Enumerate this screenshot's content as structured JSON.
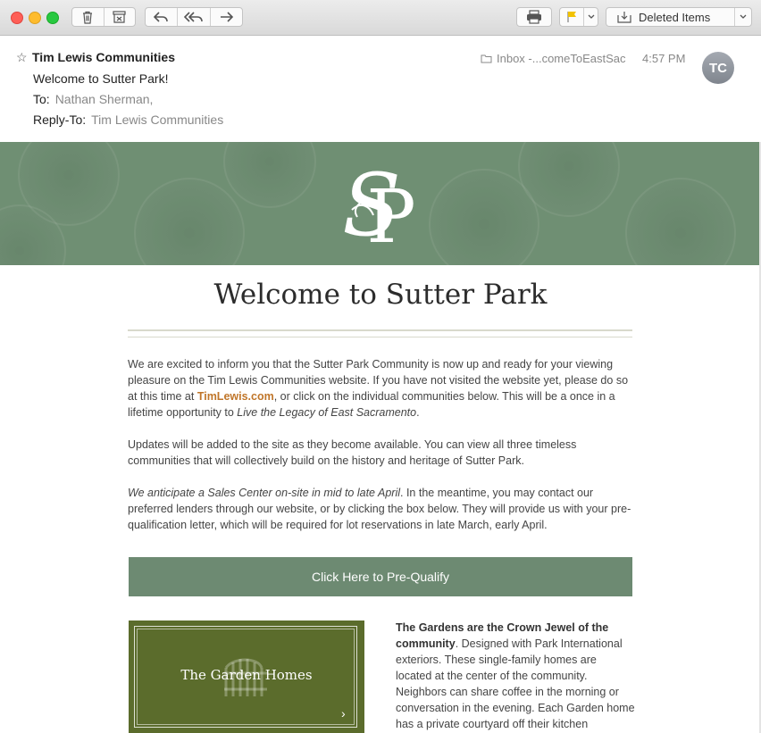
{
  "toolbar": {
    "mailbox_select": "Deleted Items"
  },
  "header": {
    "sender": "Tim Lewis Communities",
    "subject": "Welcome to Sutter Park!",
    "to_label": "To:",
    "to_value": "Nathan Sherman,",
    "reply_label": "Reply-To:",
    "reply_value": "Tim Lewis Communities",
    "mailbox": "Inbox -...comeToEastSac",
    "time": "4:57 PM",
    "avatar_initials": "TC"
  },
  "email": {
    "title": "Welcome to Sutter Park",
    "p1_a": "We are excited to inform you that the Sutter Park Community is now up and ready for your viewing pleasure on the Tim Lewis Communities website. If you have not visited the website yet, please do so at this time at ",
    "p1_link": "TimLewis.com",
    "p1_b": ", or click on the individual communities below. This will be a once in a lifetime opportunity to ",
    "p1_italic": "Live the Legacy of East Sacramento",
    "p1_end": ".",
    "p2": "Updates will be added to the site as they become available. You can view all three timeless communities that will collectively build on the history and heritage of Sutter Park.",
    "p3_italic": "We anticipate a Sales Center on-site in mid to late April",
    "p3_rest": ". In the meantime, you may contact our preferred lenders through our website, or by clicking the box below. They will provide us with your pre-qualification letter, which will be required for lot reservations in late March, early April.",
    "cta": "Click Here to Pre-Qualify",
    "card_title": "The Garden Homes",
    "gardens_bold": "The Gardens are the Crown Jewel of the community",
    "gardens_text": ".  Designed with Park International exteriors. These single-family homes are located at the center of the community. Neighbors can share coffee in the morning or conversation in the evening.  Each Garden home has a private courtyard off their kitchen"
  },
  "colors": {
    "banner": "#6f8f73",
    "cta": "#6d8a72",
    "card": "#5b6c2c",
    "link": "#c0762a"
  }
}
